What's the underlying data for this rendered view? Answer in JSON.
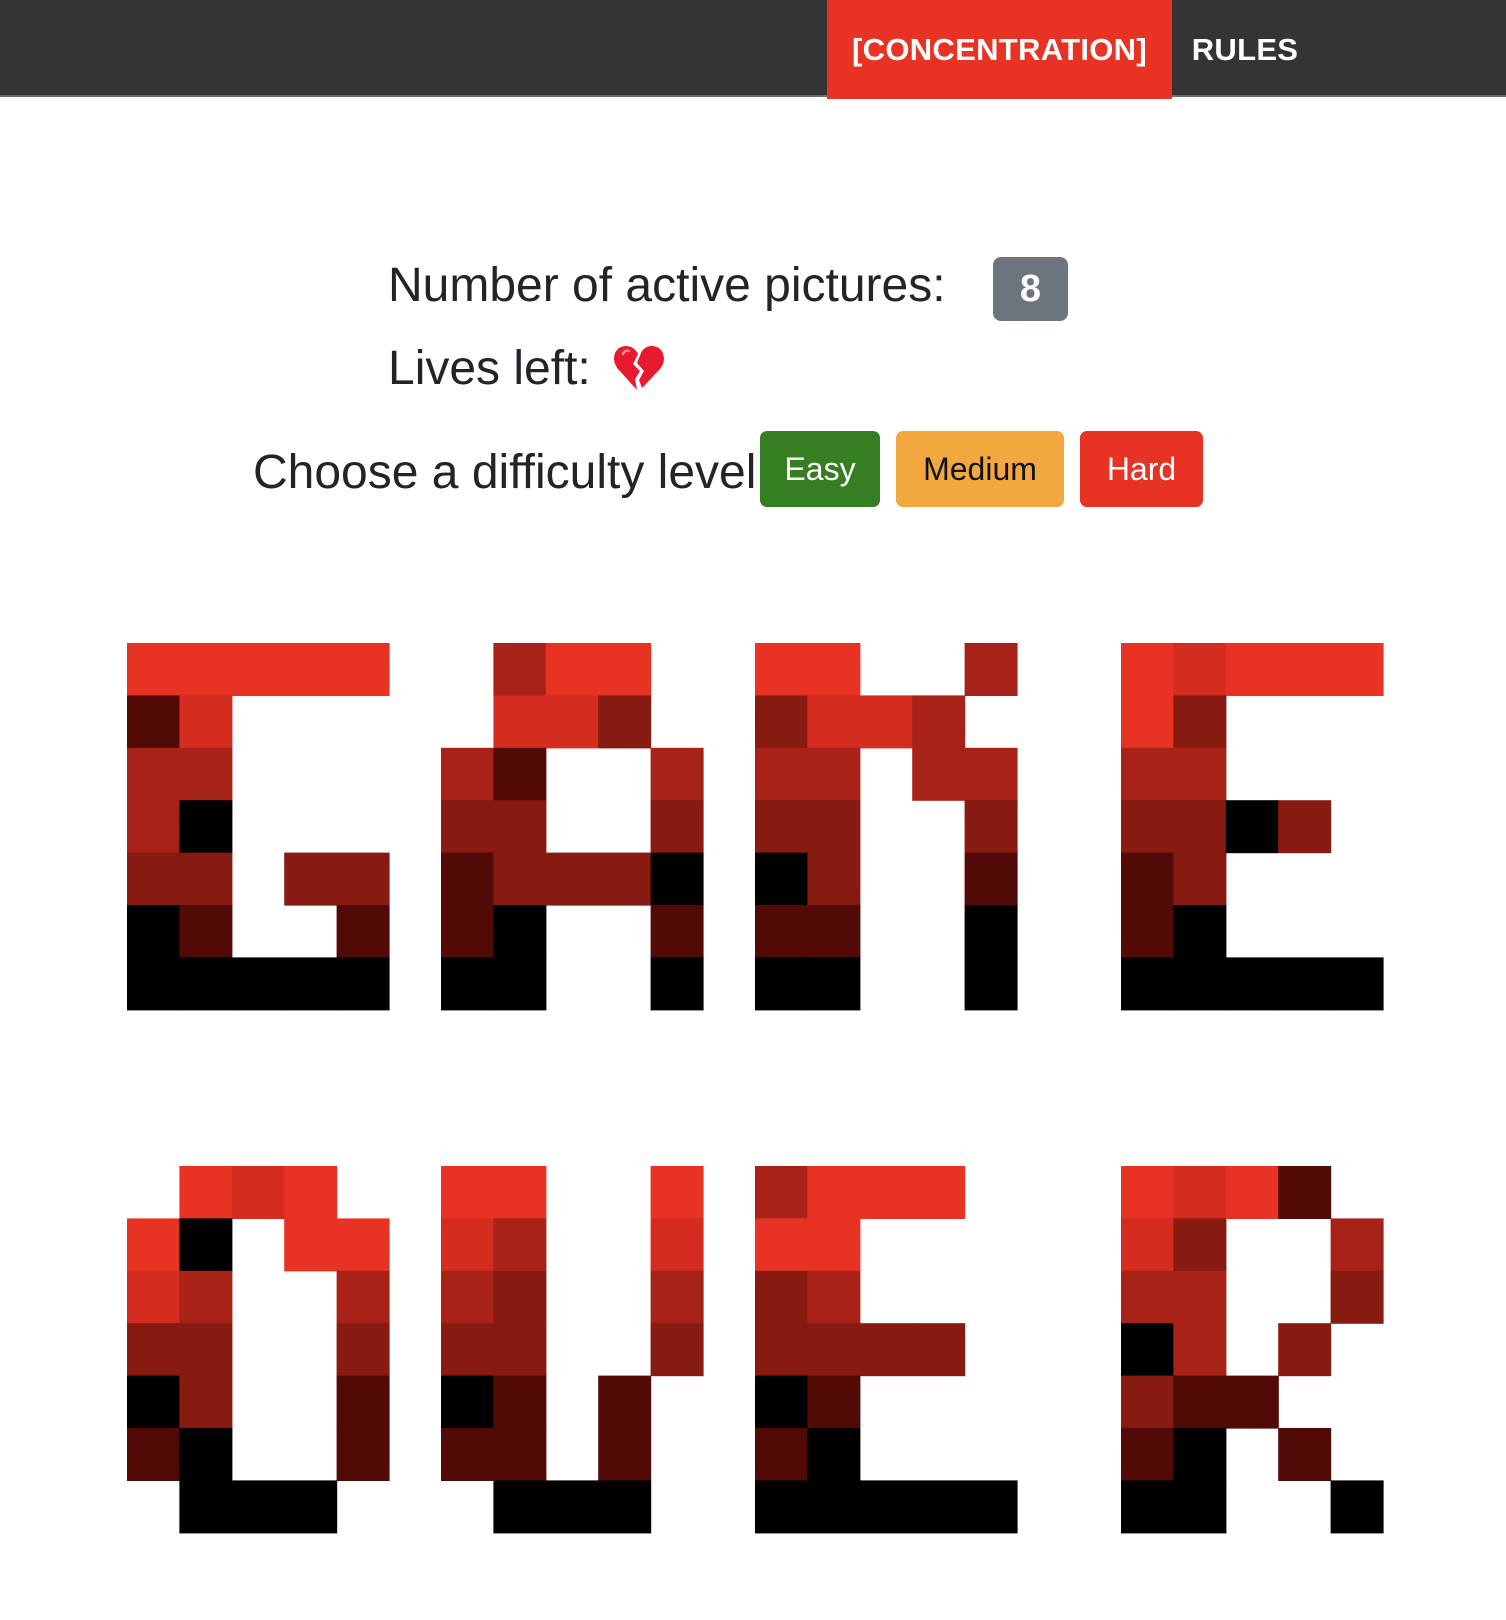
{
  "nav": {
    "active_label": "[CONCENTRATION]",
    "rules_label": "RULES"
  },
  "status": {
    "active_pictures_label": "Number of active pictures:",
    "active_pictures_count": "8",
    "lives_label": "Lives left:",
    "lives_icon": "broken-heart-icon"
  },
  "difficulty": {
    "label": "Choose a difficulty level:",
    "easy": "Easy",
    "medium": "Medium",
    "hard": "Hard"
  },
  "colors": {
    "nav_background": "#343434",
    "nav_active": "#e83324",
    "badge": "#6c757d",
    "easy": "#367e22",
    "medium": "#f2a73f",
    "hard": "#e83324"
  },
  "game_over": {
    "words": [
      "GAME",
      "OVER"
    ],
    "palette": [
      "#e83324",
      "#d52c20",
      "#a82218",
      "#871a11",
      "#520a07",
      "#000000"
    ],
    "word_grids": [
      [
        [
          "00000",
          "41...",
          "22...",
          "25...",
          "33.33",
          "54..4",
          "55555"
        ],
        [
          ".200.",
          ".113.",
          "24..2",
          "33..3",
          "4333x",
          "45..4",
          "55..5"
        ],
        [
          "00..2",
          "3112.",
          "22.22",
          "33..3",
          "53..4",
          "44..5",
          "55..5"
        ],
        [
          "01000",
          "03...",
          "22...",
          "3353.",
          "43...",
          "45...",
          "55555"
        ]
      ],
      [
        [
          ".010.",
          "05.00",
          "12..2",
          "33..3",
          "53..4",
          "45..4",
          ".555."
        ],
        [
          "00..0",
          "12..1",
          "23..2",
          "33..3",
          "54.4.",
          "44.4.",
          ".555."
        ],
        [
          "2000.",
          "00...",
          "32...",
          "3333.",
          "54...",
          "45...",
          "55555"
        ],
        [
          "0104.",
          "13..2",
          "22..3",
          "52.3.",
          "344..",
          "45.4.",
          "55..5"
        ]
      ]
    ]
  }
}
